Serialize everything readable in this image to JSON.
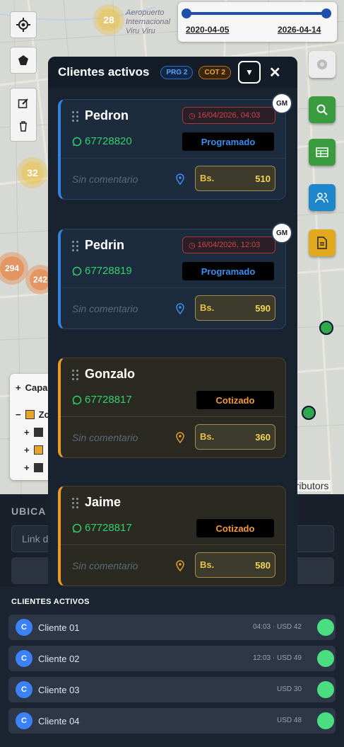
{
  "map": {
    "clusters": [
      "28",
      "32",
      "294",
      "242"
    ],
    "airport_label": "Aeropuerto Internacional Viru Viru",
    "date_start": "2020-04-05",
    "date_end": "2026-04-14",
    "layers_label": "Capa",
    "zone_label": "Zo",
    "attribution": "ntributors"
  },
  "ubicacion": {
    "title": "UBICA",
    "input_placeholder": "Link d"
  },
  "modal": {
    "title": "Clientes activos",
    "prg_badge": "PRG 2",
    "cot_badge": "COT 2",
    "toggle_icon": "▼",
    "close_icon": "✕",
    "cards": [
      {
        "name": "Pedron",
        "phone": "67728820",
        "status": "Programado",
        "date": "16/04/2026, 04:03",
        "comment": "Sin comentario",
        "currency": "Bs.",
        "amount": "510",
        "badge": "GM"
      },
      {
        "name": "Pedrin",
        "phone": "67728819",
        "status": "Programado",
        "date": "16/04/2026, 12:03",
        "comment": "Sin comentario",
        "currency": "Bs.",
        "amount": "590",
        "badge": "GM"
      },
      {
        "name": "Gonzalo",
        "phone": "67728817",
        "status": "Cotizado",
        "comment": "Sin comentario",
        "currency": "Bs.",
        "amount": "360"
      },
      {
        "name": "Jaime",
        "phone": "67728817",
        "status": "Cotizado",
        "comment": "Sin comentario",
        "currency": "Bs.",
        "amount": "580"
      }
    ]
  },
  "list": {
    "title": "CLIENTES ACTIVOS",
    "rows": [
      {
        "initial": "C",
        "name": "Cliente 01",
        "meta": "04:03 · USD 42"
      },
      {
        "initial": "C",
        "name": "Cliente 02",
        "meta": "12:03 · USD 49"
      },
      {
        "initial": "C",
        "name": "Cliente 03",
        "meta": "USD 30"
      },
      {
        "initial": "C",
        "name": "Cliente 04",
        "meta": "USD 48"
      }
    ]
  }
}
